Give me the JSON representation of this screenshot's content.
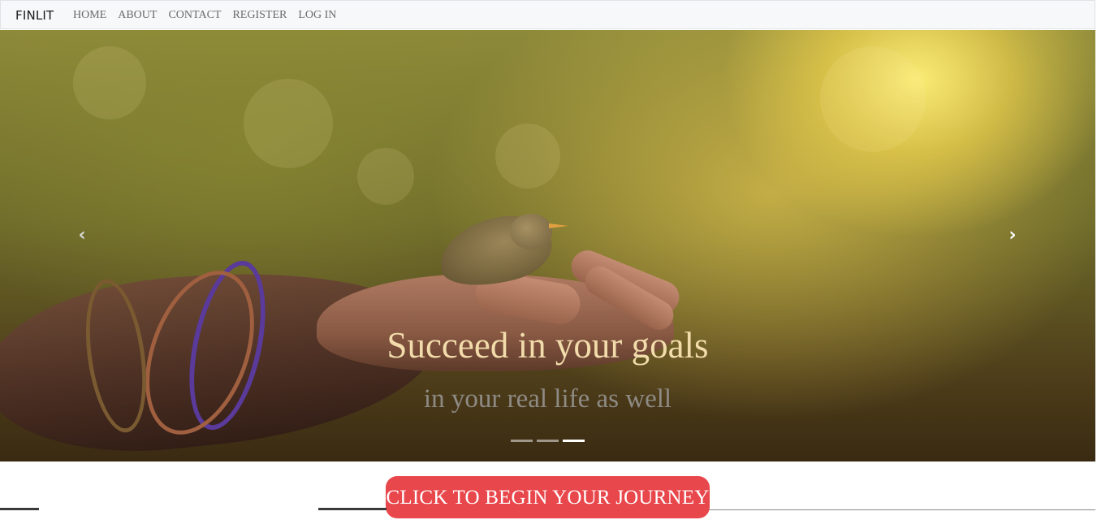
{
  "navbar": {
    "brand": "FINLIT",
    "links": [
      "HOME",
      "ABOUT",
      "CONTACT",
      "REGISTER",
      "LOG IN"
    ]
  },
  "carousel": {
    "title": "Succeed in your goals",
    "subtitle": "in your real life as well",
    "prev_icon": "chevron-left-icon",
    "next_icon": "chevron-right-icon",
    "prev_glyph": "‹",
    "next_glyph": "›",
    "slide_count": 3,
    "active_slide": 3
  },
  "cta": {
    "label": "CLICK TO BEGIN YOUR JOURNEY"
  },
  "colors": {
    "navbar_bg": "#f7f8fa",
    "nav_link": "#6a6a6a",
    "caption_title": "#f2dcab",
    "caption_subtitle": "#8e8a84",
    "cta_bg": "#e8474c",
    "cta_text": "#ffffff"
  }
}
